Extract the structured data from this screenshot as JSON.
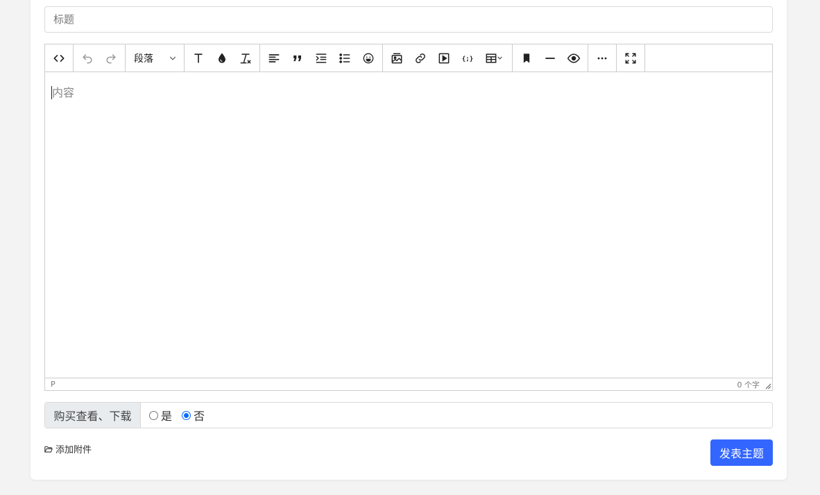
{
  "form": {
    "title_placeholder": "标题",
    "content_placeholder": "内容",
    "submit_label": "发表主题",
    "attach_label": "添加附件"
  },
  "toolbar": {
    "block_format": "段落",
    "icons": [
      "source-code-icon",
      "undo-icon",
      "redo-icon",
      "block-format-select",
      "text-size-icon",
      "text-color-icon",
      "clear-format-icon",
      "align-left-icon",
      "blockquote-icon",
      "indent-icon",
      "bullet-list-icon",
      "emoji-icon",
      "image-icon",
      "link-icon",
      "media-icon",
      "code-sample-icon",
      "table-icon",
      "anchor-icon",
      "horizontal-rule-icon",
      "preview-icon",
      "more-icon",
      "fullscreen-icon"
    ]
  },
  "statusbar": {
    "path": "P",
    "word_count": "0 个字"
  },
  "purchase": {
    "label": "购买查看、下载",
    "options": [
      {
        "label": "是",
        "checked": false
      },
      {
        "label": "否",
        "checked": true
      }
    ]
  },
  "colors": {
    "accent": "#3366ff",
    "radio": "#0a6cff",
    "border": "#cccccc",
    "background": "#f3f3f3"
  }
}
